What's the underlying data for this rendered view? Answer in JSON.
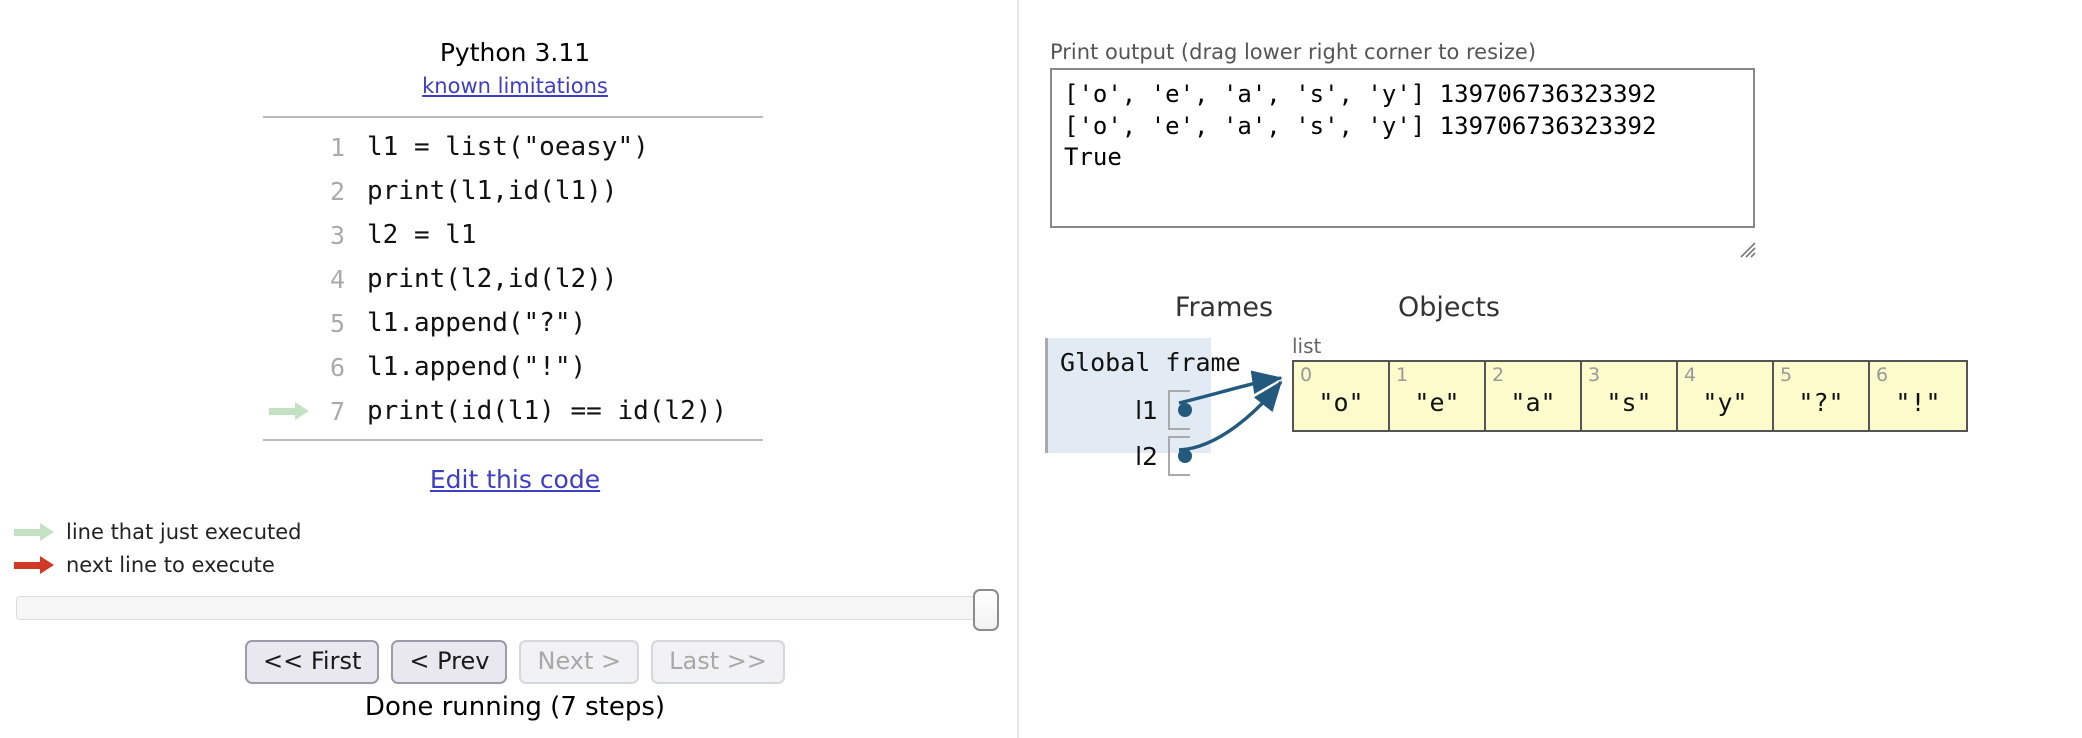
{
  "left": {
    "python_version": "Python 3.11",
    "known_limitations_link": "known limitations",
    "code_lines": [
      {
        "number": "1",
        "text": "l1 = list(\"oeasy\")",
        "arrow": "none"
      },
      {
        "number": "2",
        "text": "print(l1,id(l1))",
        "arrow": "none"
      },
      {
        "number": "3",
        "text": "l2 = l1",
        "arrow": "none"
      },
      {
        "number": "4",
        "text": "print(l2,id(l2))",
        "arrow": "none"
      },
      {
        "number": "5",
        "text": "l1.append(\"?\")",
        "arrow": "none"
      },
      {
        "number": "6",
        "text": "l1.append(\"!\")",
        "arrow": "none"
      },
      {
        "number": "7",
        "text": "print(id(l1) == id(l2))",
        "arrow": "green"
      }
    ],
    "edit_code_link": "Edit this code",
    "legend": [
      {
        "arrow": "green",
        "label": "line that just executed"
      },
      {
        "arrow": "red",
        "label": "next line to execute"
      }
    ],
    "nav_buttons": [
      {
        "label": "<< First",
        "enabled": true
      },
      {
        "label": "< Prev",
        "enabled": true
      },
      {
        "label": "Next >",
        "enabled": false
      },
      {
        "label": "Last >>",
        "enabled": false
      }
    ],
    "run_status": "Done running (7 steps)"
  },
  "right": {
    "print_output_label": "Print output (drag lower right corner to resize)",
    "print_output_text": "['o', 'e', 'a', 's', 'y'] 139706736323392\n['o', 'e', 'a', 's', 'y'] 139706736323392\nTrue",
    "frames_heading": "Frames",
    "objects_heading": "Objects",
    "global_frame": {
      "title": "Global frame",
      "variables": [
        {
          "name": "l1"
        },
        {
          "name": "l2"
        }
      ]
    },
    "list_object": {
      "type_label": "list",
      "cells": [
        {
          "index": "0",
          "value": "\"o\""
        },
        {
          "index": "1",
          "value": "\"e\""
        },
        {
          "index": "2",
          "value": "\"a\""
        },
        {
          "index": "3",
          "value": "\"s\""
        },
        {
          "index": "4",
          "value": "\"y\""
        },
        {
          "index": "5",
          "value": "\"?\""
        },
        {
          "index": "6",
          "value": "\"!\""
        }
      ]
    }
  },
  "colors": {
    "link": "#3d3dc6",
    "green_arrow": "#c3e2c3",
    "red_arrow": "#cf3a27",
    "frame_bg": "#e2eaf4",
    "list_cell_bg": "#fbfbcc",
    "pointer_arrow": "#23597d"
  }
}
